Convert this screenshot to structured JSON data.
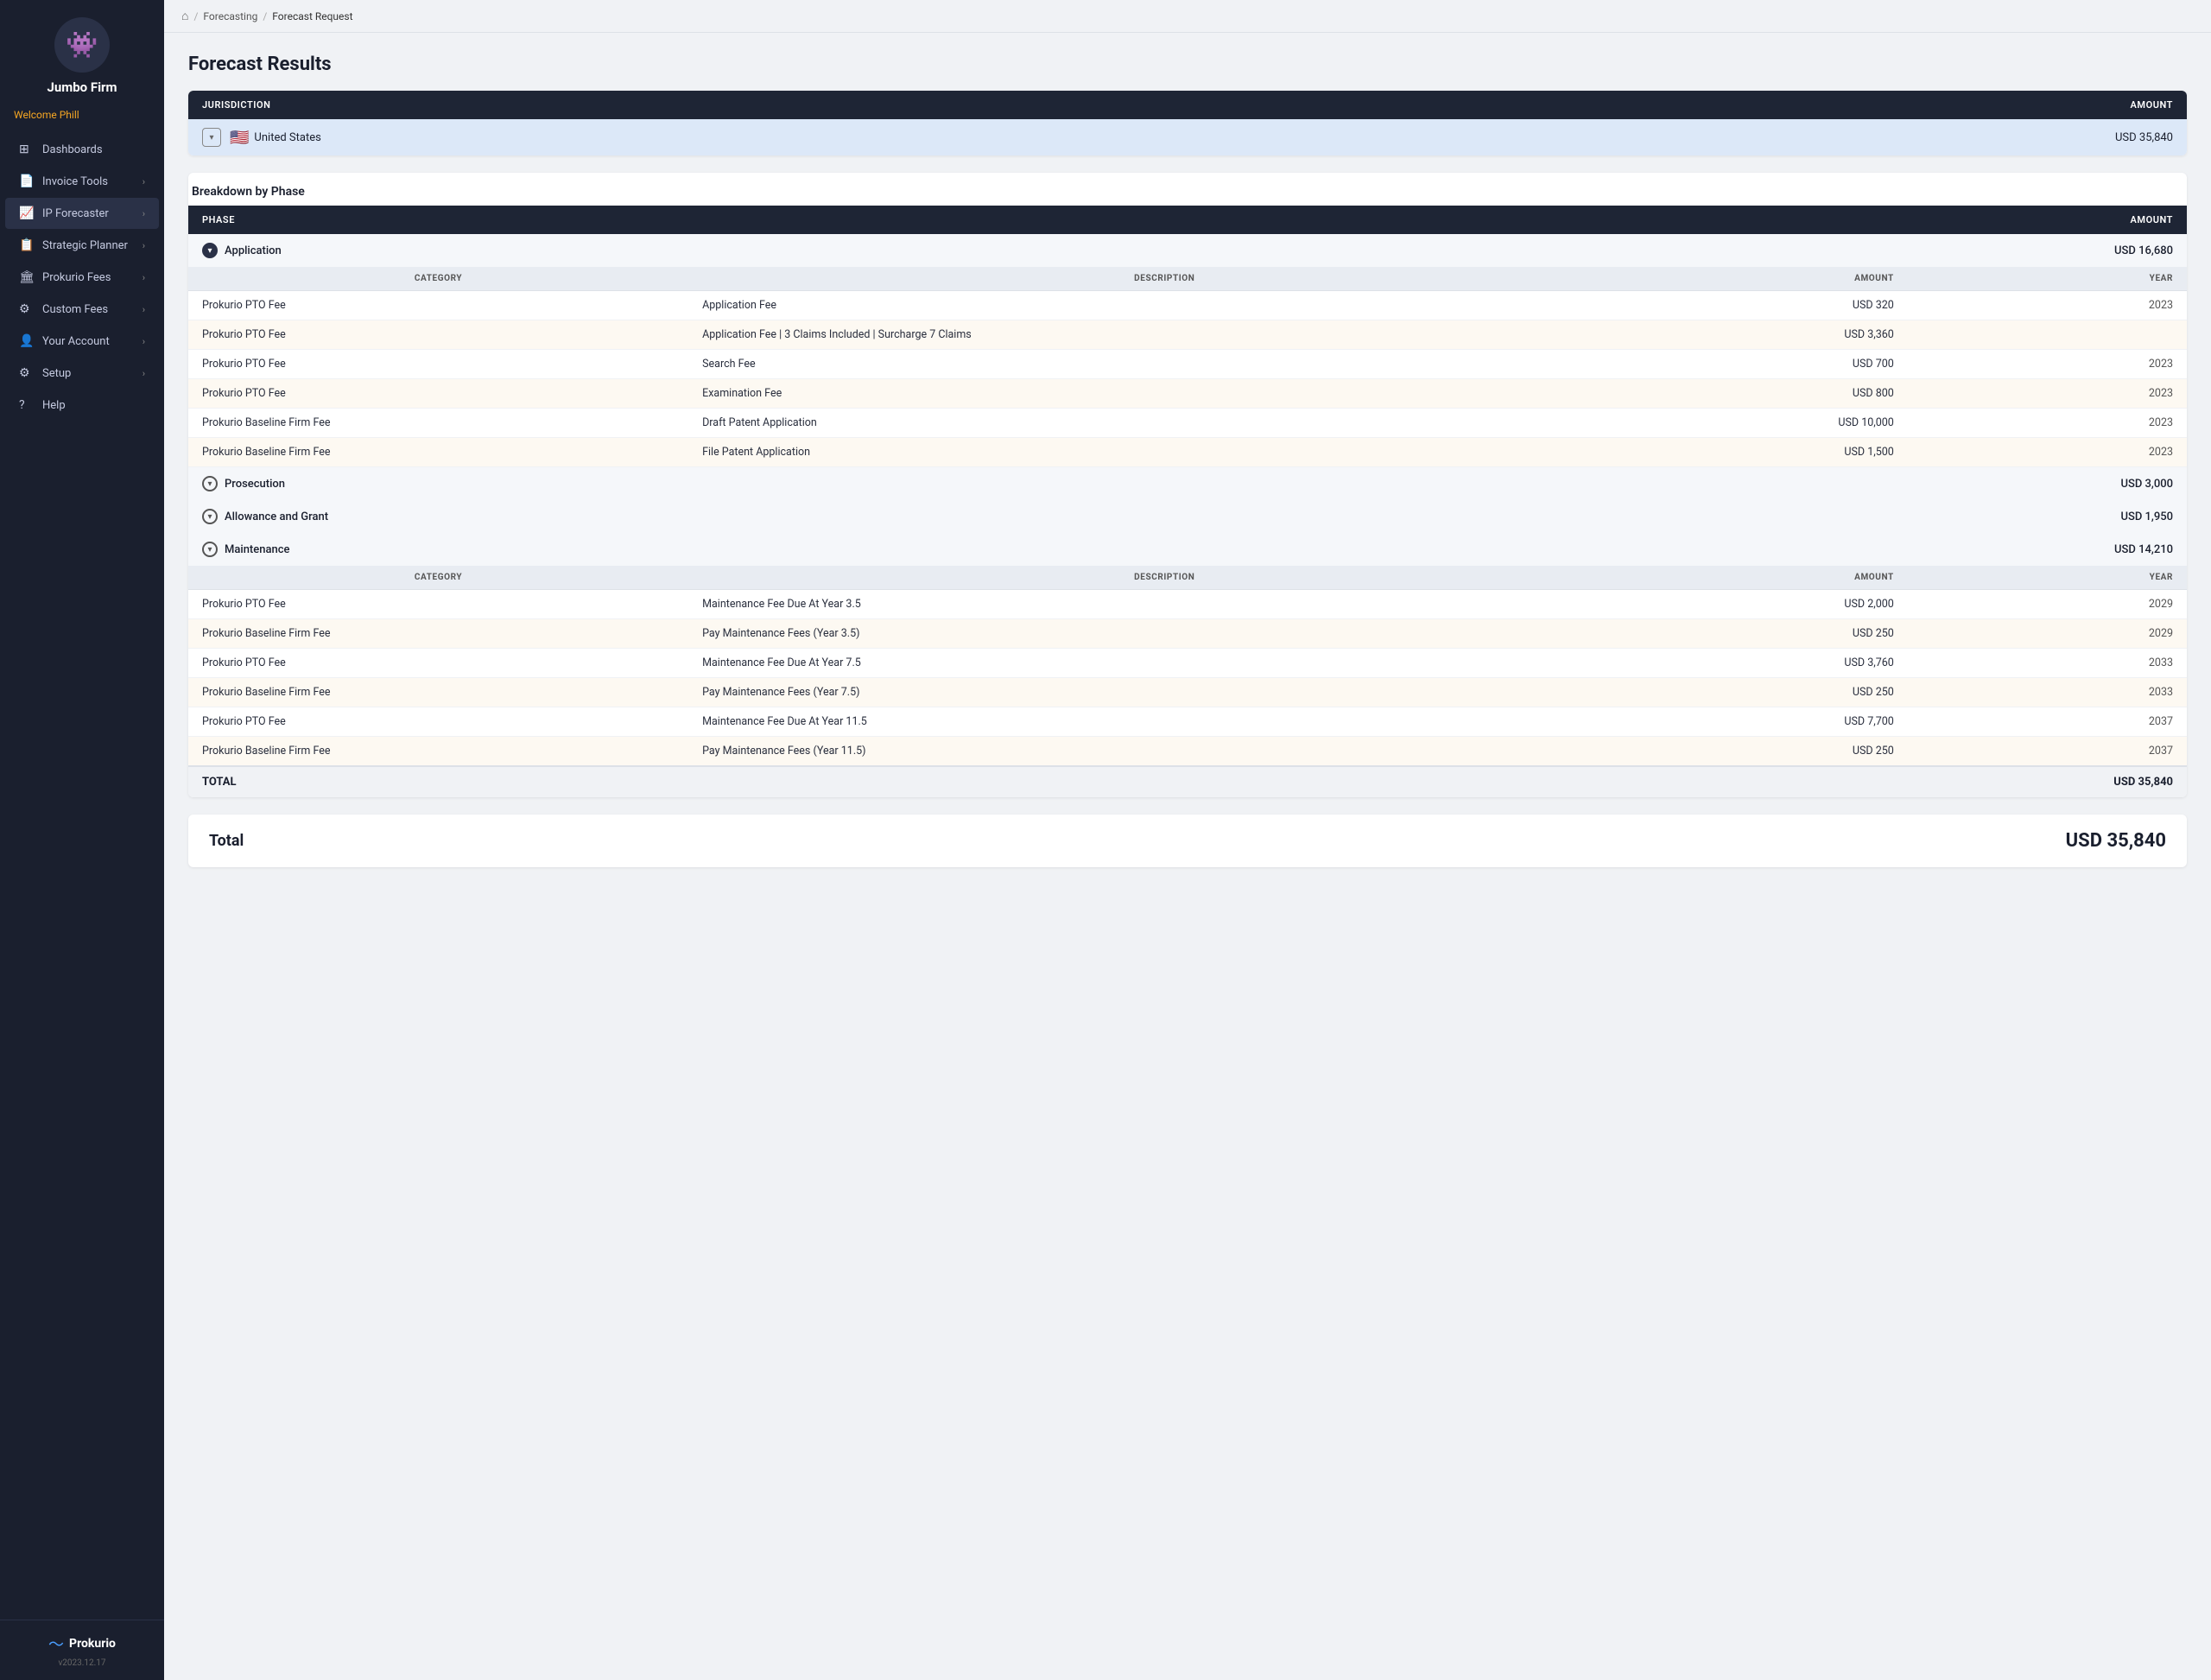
{
  "sidebar": {
    "firm_name": "Jumbo Firm",
    "welcome": "Welcome Phill",
    "logo_emoji": "👾",
    "nav_items": [
      {
        "id": "dashboards",
        "label": "Dashboards",
        "icon": "⊞",
        "has_chevron": false
      },
      {
        "id": "invoice-tools",
        "label": "Invoice Tools",
        "icon": "🧾",
        "has_chevron": true
      },
      {
        "id": "ip-forecaster",
        "label": "IP Forecaster",
        "icon": "📈",
        "has_chevron": true
      },
      {
        "id": "strategic-planner",
        "label": "Strategic Planner",
        "icon": "📋",
        "has_chevron": true
      },
      {
        "id": "prokurio-fees",
        "label": "Prokurio Fees",
        "icon": "🏛",
        "has_chevron": true
      },
      {
        "id": "custom-fees",
        "label": "Custom Fees",
        "icon": "⚙",
        "has_chevron": true
      },
      {
        "id": "your-account",
        "label": "Your Account",
        "icon": "👤",
        "has_chevron": true
      },
      {
        "id": "setup",
        "label": "Setup",
        "icon": "⚙",
        "has_chevron": true
      },
      {
        "id": "help",
        "label": "Help",
        "icon": "❓",
        "has_chevron": false
      }
    ],
    "brand": "Prokurio",
    "version": "v2023.12.17"
  },
  "breadcrumb": {
    "home": "home",
    "items": [
      "Forecasting",
      "Forecast Request"
    ]
  },
  "page": {
    "title": "Forecast Results"
  },
  "jurisdiction_table": {
    "col_jurisdiction": "JURISDICTION",
    "col_amount": "AMOUNT",
    "row": {
      "flag": "🇺🇸",
      "country": "United States",
      "amount": "USD 35,840"
    }
  },
  "breakdown_title": "Breakdown by Phase",
  "phase_table": {
    "col_phase": "PHASE",
    "col_amount": "AMOUNT"
  },
  "sub_cols": {
    "category": "CATEGORY",
    "description": "DESCRIPTION",
    "amount": "AMOUNT",
    "year": "YEAR"
  },
  "phases": [
    {
      "name": "Application",
      "amount": "USD 16,680",
      "expanded": true,
      "rows": [
        {
          "category": "Prokurio PTO Fee",
          "description": "Application Fee",
          "amount": "USD 320",
          "year": "2023"
        },
        {
          "category": "Prokurio PTO Fee",
          "description": "Application Fee | 3 Claims Included | Surcharge 7 Claims",
          "amount": "USD 3,360",
          "year": ""
        },
        {
          "category": "Prokurio PTO Fee",
          "description": "Search Fee",
          "amount": "USD 700",
          "year": "2023"
        },
        {
          "category": "Prokurio PTO Fee",
          "description": "Examination Fee",
          "amount": "USD 800",
          "year": "2023"
        },
        {
          "category": "Prokurio Baseline Firm Fee",
          "description": "Draft Patent Application",
          "amount": "USD 10,000",
          "year": "2023"
        },
        {
          "category": "Prokurio Baseline Firm Fee",
          "description": "File Patent Application",
          "amount": "USD 1,500",
          "year": "2023"
        }
      ]
    },
    {
      "name": "Prosecution",
      "amount": "USD 3,000",
      "expanded": false,
      "rows": []
    },
    {
      "name": "Allowance and Grant",
      "amount": "USD 1,950",
      "expanded": false,
      "rows": []
    },
    {
      "name": "Maintenance",
      "amount": "USD 14,210",
      "expanded": true,
      "rows": [
        {
          "category": "Prokurio PTO Fee",
          "description": "Maintenance Fee Due At Year 3.5",
          "amount": "USD 2,000",
          "year": "2029"
        },
        {
          "category": "Prokurio Baseline Firm Fee",
          "description": "Pay Maintenance Fees (Year 3.5)",
          "amount": "USD 250",
          "year": "2029"
        },
        {
          "category": "Prokurio PTO Fee",
          "description": "Maintenance Fee Due At Year 7.5",
          "amount": "USD 3,760",
          "year": "2033"
        },
        {
          "category": "Prokurio Baseline Firm Fee",
          "description": "Pay Maintenance Fees (Year 7.5)",
          "amount": "USD 250",
          "year": "2033"
        },
        {
          "category": "Prokurio PTO Fee",
          "description": "Maintenance Fee Due At Year 11.5",
          "amount": "USD 7,700",
          "year": "2037"
        },
        {
          "category": "Prokurio Baseline Firm Fee",
          "description": "Pay Maintenance Fees (Year 11.5)",
          "amount": "USD 250",
          "year": "2037"
        }
      ]
    }
  ],
  "total_row_label": "TOTAL",
  "total_row_amount": "USD 35,840",
  "total_card": {
    "label": "Total",
    "amount": "USD 35,840"
  }
}
